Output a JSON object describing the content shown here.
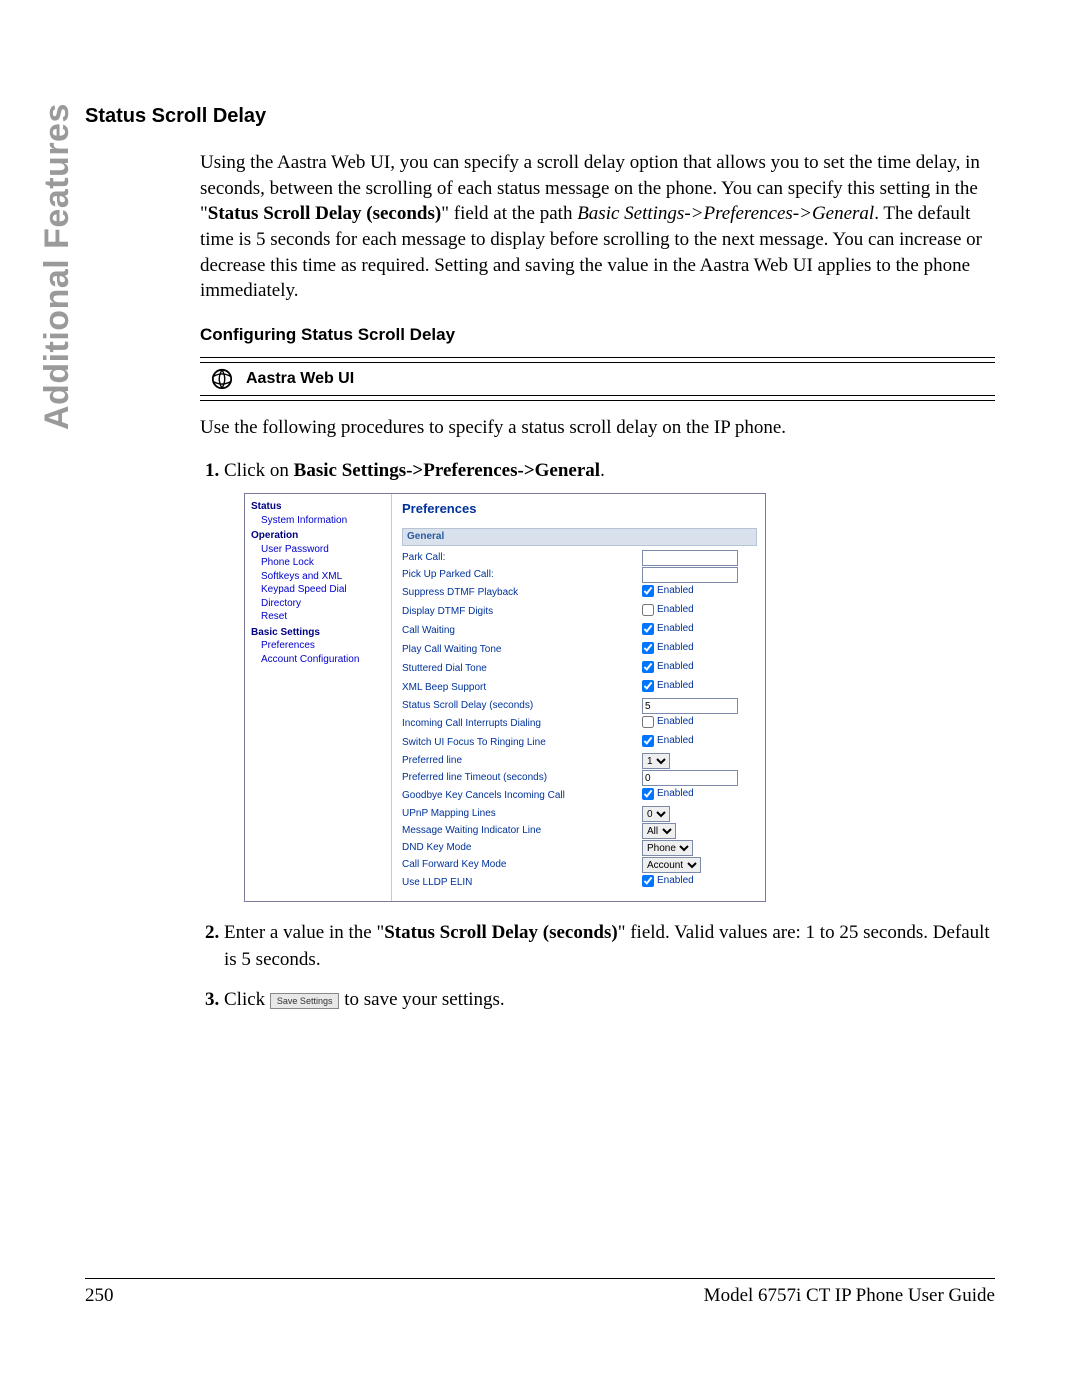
{
  "sidebar_tab": "Additional Features",
  "heading": "Status Scroll Delay",
  "intro_parts": {
    "p1a": "Using the Aastra Web UI, you can specify a scroll delay option that allows you to set the time delay, in seconds, between the scrolling of each status message on the phone. You can specify this setting in the \"",
    "p1_bold": "Status Scroll Delay (seconds)",
    "p1b": "\" field at the path ",
    "p1_italic": "Basic Settings->Preferences->General",
    "p1c": ". The default time is 5 seconds for each message to display before scrolling to the next message. You can increase or decrease this time as required. Setting and saving the value in the Aastra Web UI applies to the phone immediately."
  },
  "sub1": "Configuring Status Scroll Delay",
  "web_ui_label": "Aastra Web UI",
  "intro2": "Use the following procedures to specify a status scroll delay on the IP phone.",
  "steps": {
    "s1a": "Click on ",
    "s1b": "Basic Settings->Preferences->General",
    "s1c": ".",
    "s2a": "Enter a value in the \"",
    "s2b": "Status Scroll Delay (seconds)",
    "s2c": "\" field. Valid values are: 1 to 25 seconds. Default is 5 seconds.",
    "s3a": "Click ",
    "s3_btn": "Save Settings",
    "s3b": " to save your settings."
  },
  "ui": {
    "title": "Preferences",
    "section": "General",
    "nav": {
      "status": "Status",
      "status_items": [
        "System Information"
      ],
      "operation": "Operation",
      "operation_items": [
        "User Password",
        "Phone Lock",
        "Softkeys and XML",
        "Keypad Speed Dial",
        "Directory",
        "Reset"
      ],
      "basic": "Basic Settings",
      "basic_items": [
        "Preferences",
        "Account Configuration"
      ]
    },
    "rows": [
      {
        "label": "Park Call:",
        "type": "text",
        "value": ""
      },
      {
        "label": "Pick Up Parked Call:",
        "type": "text",
        "value": ""
      },
      {
        "label": "Suppress DTMF Playback",
        "type": "check",
        "checked": true,
        "text": "Enabled"
      },
      {
        "label": "Display DTMF Digits",
        "type": "check",
        "checked": false,
        "text": "Enabled"
      },
      {
        "label": "Call Waiting",
        "type": "check",
        "checked": true,
        "text": "Enabled"
      },
      {
        "label": "Play Call Waiting Tone",
        "type": "check",
        "checked": true,
        "text": "Enabled"
      },
      {
        "label": "Stuttered Dial Tone",
        "type": "check",
        "checked": true,
        "text": "Enabled"
      },
      {
        "label": "XML Beep Support",
        "type": "check",
        "checked": true,
        "text": "Enabled"
      },
      {
        "label": "Status Scroll Delay (seconds)",
        "type": "text",
        "value": "5"
      },
      {
        "label": "Incoming Call Interrupts Dialing",
        "type": "check",
        "checked": false,
        "text": "Enabled"
      },
      {
        "label": "Switch UI Focus To Ringing Line",
        "type": "check",
        "checked": true,
        "text": "Enabled"
      },
      {
        "label": "Preferred line",
        "type": "select",
        "value": "1"
      },
      {
        "label": "Preferred line Timeout (seconds)",
        "type": "text",
        "value": "0"
      },
      {
        "label": "Goodbye Key Cancels Incoming Call",
        "type": "check",
        "checked": true,
        "text": "Enabled"
      },
      {
        "label": "UPnP Mapping Lines",
        "type": "select",
        "value": "0"
      },
      {
        "label": "Message Waiting Indicator Line",
        "type": "select",
        "value": "All"
      },
      {
        "label": "DND Key Mode",
        "type": "select",
        "value": "Phone"
      },
      {
        "label": "Call Forward Key Mode",
        "type": "select",
        "value": "Account"
      },
      {
        "label": "Use LLDP ELIN",
        "type": "check",
        "checked": true,
        "text": "Enabled"
      }
    ]
  },
  "footer": {
    "page": "250",
    "doc": "Model 6757i CT IP Phone User Guide"
  }
}
